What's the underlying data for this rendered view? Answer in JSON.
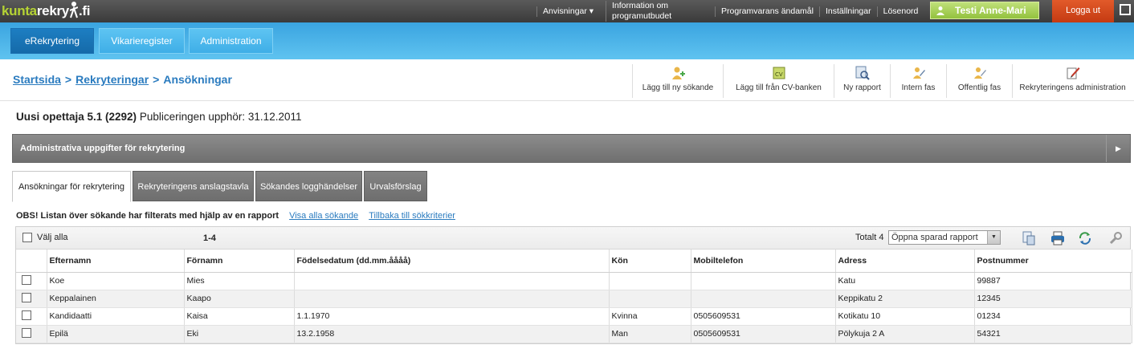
{
  "topbar": {
    "logo": {
      "part1": "kunta",
      "part2": "rekry",
      "part3": ".fi"
    },
    "links": [
      {
        "label": "Anvisningar ▾"
      },
      {
        "label": "Information om programutbudet"
      },
      {
        "label": "Programvarans ändamål"
      },
      {
        "label": "Inställningar"
      },
      {
        "label": "Lösenord"
      }
    ],
    "user": "Testi Anne-Mari",
    "logout": "Logga ut",
    "user_color": "#93c23d",
    "logout_color": "#c43a12"
  },
  "nav": {
    "tabs": [
      {
        "label": "eRekrytering",
        "active": true
      },
      {
        "label": "Vikarieregister",
        "active": false
      },
      {
        "label": "Administration",
        "active": false
      }
    ]
  },
  "breadcrumb": {
    "items": [
      "Startsida",
      "Rekryteringar",
      "Ansökningar"
    ],
    "separator": ">"
  },
  "actions": [
    {
      "label": "Lägg till ny sökande",
      "icon": "user-add-icon"
    },
    {
      "label": "Lägg till från CV-banken",
      "icon": "cv-icon"
    },
    {
      "label": "Ny rapport",
      "icon": "report-search-icon"
    },
    {
      "label": "Intern fas",
      "icon": "edit-phase-icon"
    },
    {
      "label": "Offentlig fas",
      "icon": "public-phase-icon"
    },
    {
      "label": "Rekryteringens administration",
      "icon": "pencil-admin-icon"
    }
  ],
  "recruitment": {
    "name": "Uusi opettaja 5.1 (2292)",
    "pub_label": "Publiceringen upphör: 31.12.2011"
  },
  "admin_panel": {
    "label": "Administrativa uppgifter för rekrytering"
  },
  "tabs": [
    {
      "label": "Ansökningar för rekrytering",
      "active": true
    },
    {
      "label": "Rekryteringens anslagstavla",
      "active": false
    },
    {
      "label": "Sökandes logghändelser",
      "active": false
    },
    {
      "label": "Urvalsförslag",
      "active": false
    }
  ],
  "notice": {
    "text": "OBS! Listan över sökande har filterats med hjälp av en rapport",
    "link1": "Visa alla sökande",
    "link2": "Tillbaka till sökkriterier"
  },
  "table": {
    "select_all": "Välj alla",
    "range": "1-4",
    "total": "Totalt 4",
    "report_select": "Öppna sparad rapport",
    "columns": [
      "Efternamn",
      "Förnamn",
      "Födelsedatum (dd.mm.åååå)",
      "Kön",
      "Mobiltelefon",
      "Adress",
      "Postnummer"
    ],
    "rows": [
      [
        "Koe",
        "Mies",
        "",
        "",
        "",
        "Katu",
        "99887"
      ],
      [
        "Keppalainen",
        "Kaapo",
        "",
        "",
        "",
        "Keppikatu 2",
        "12345"
      ],
      [
        "Kandidaatti",
        "Kaisa",
        "1.1.1970",
        "Kvinna",
        "0505609531",
        "Kotikatu 10",
        "01234"
      ],
      [
        "Epilä",
        "Eki",
        "13.2.1958",
        "Man",
        "0505609531",
        "Pölykuja 2 A",
        "54321"
      ]
    ]
  }
}
